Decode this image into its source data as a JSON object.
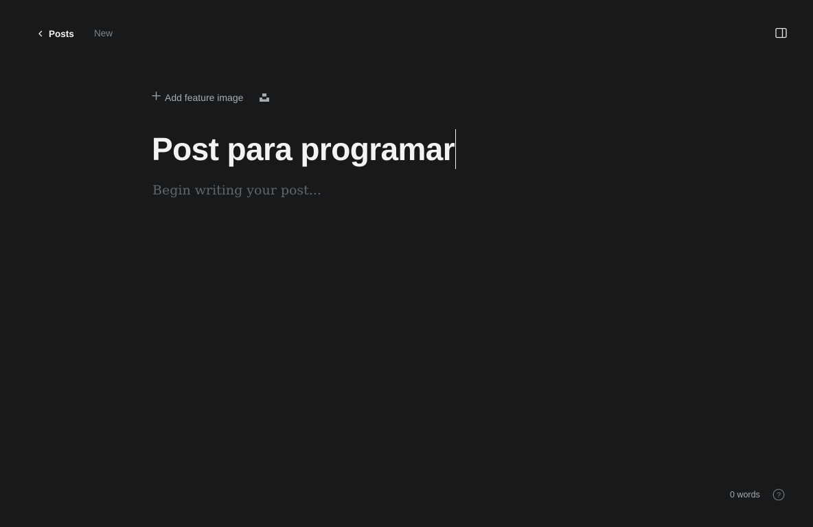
{
  "header": {
    "back_label": "Posts",
    "status": "New"
  },
  "editor": {
    "add_feature_image_label": "Add feature image",
    "title": "Post para programar",
    "body_placeholder": "Begin writing your post..."
  },
  "footer": {
    "word_count": "0 words",
    "help_symbol": "?"
  },
  "icons": {
    "back": "chevron-left-icon",
    "sidebar": "sidebar-toggle-icon",
    "add": "plus-icon",
    "unsplash": "unsplash-icon",
    "help": "question-circle-icon"
  },
  "colors": {
    "background": "#18191b",
    "title": "#f1f3f4",
    "muted": "#7e858c",
    "placeholder": "#5f666d"
  }
}
